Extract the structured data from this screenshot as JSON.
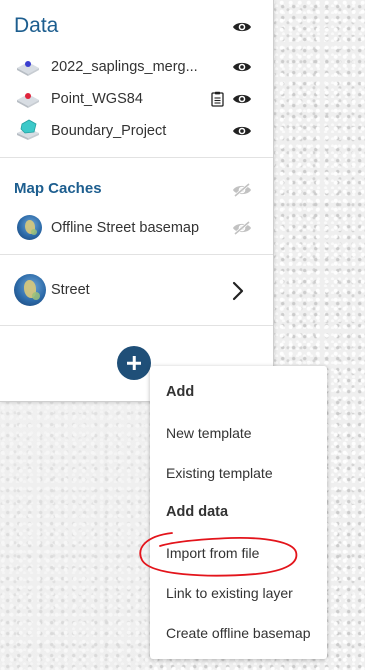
{
  "data_section": {
    "title": "Data",
    "title_visibility_icon": "eye-icon",
    "layers": [
      {
        "name": "2022_saplings_merg...",
        "icon": "point-layer-icon",
        "dot_color": "#3b3fd0",
        "visibility_icon": "eye-icon"
      },
      {
        "name": "Point_WGS84",
        "icon": "point-layer-icon",
        "dot_color": "#e0243c",
        "extra_icon": "form-icon",
        "visibility_icon": "eye-icon"
      },
      {
        "name": "Boundary_Project",
        "icon": "polygon-layer-icon",
        "fill_color": "#3cc9c9",
        "visibility_icon": "eye-icon"
      }
    ]
  },
  "map_caches": {
    "title": "Map Caches",
    "title_visibility_icon": "eye-off-icon",
    "items": [
      {
        "name": "Offline Street basemap",
        "icon": "globe-icon",
        "visibility_icon": "eye-off-icon"
      }
    ]
  },
  "basemap": {
    "name": "Street",
    "icon": "globe-icon",
    "action_icon": "chevron-right-icon"
  },
  "add_button": {
    "icon": "plus-icon",
    "color": "#1f4f78"
  },
  "menu": {
    "add_heading": "Add",
    "add_items": [
      "New template",
      "Existing template"
    ],
    "add_data_heading": "Add data",
    "add_data_items": [
      "Import from file",
      "Link to existing layer",
      "Create offline basemap"
    ],
    "highlight_color": "#e3141b"
  },
  "colors": {
    "accent": "#1d5e8f",
    "text": "#333333",
    "icon": "#222222"
  }
}
